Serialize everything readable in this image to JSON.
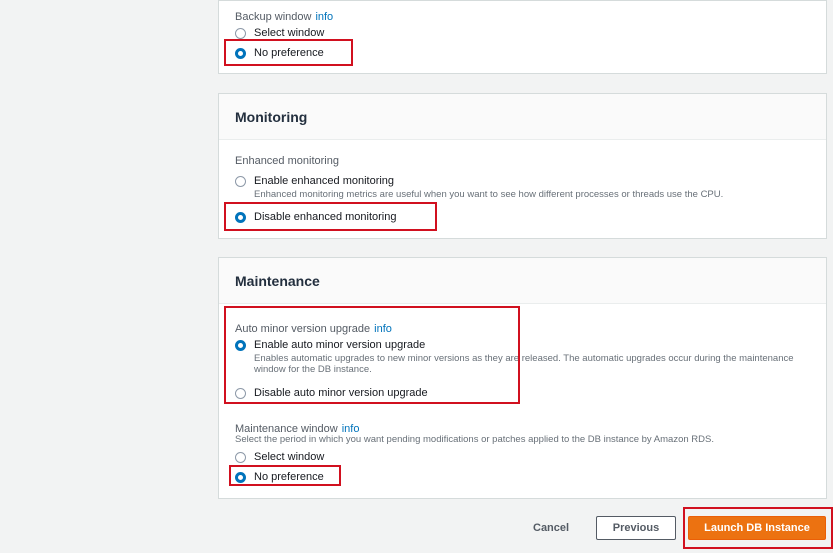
{
  "backup": {
    "label": "Backup window",
    "info": "info",
    "options": [
      "Select window",
      "No preference"
    ]
  },
  "monitoring": {
    "title": "Monitoring",
    "label": "Enhanced monitoring",
    "enable_label": "Enable enhanced monitoring",
    "enable_desc": "Enhanced monitoring metrics are useful when you want to see how different processes or threads use the CPU.",
    "disable_label": "Disable enhanced monitoring"
  },
  "maintenance": {
    "title": "Maintenance",
    "auto_label": "Auto minor version upgrade",
    "auto_info": "info",
    "enable_label": "Enable auto minor version upgrade",
    "enable_desc_1": "Enables automatic upgrades to new minor versions as they are released. The automatic upgrades occur during the maintenance",
    "enable_desc_2": "window for the DB instance.",
    "disable_label": "Disable auto minor version upgrade",
    "window_label": "Maintenance window",
    "window_info": "info",
    "window_desc": "Select the period in which you want pending modifications or patches applied to the DB instance by Amazon RDS.",
    "window_options": [
      "Select window",
      "No preference"
    ]
  },
  "footer": {
    "cancel": "Cancel",
    "previous": "Previous",
    "launch": "Launch DB Instance"
  },
  "colors": {
    "accent": "#0073bb",
    "primary_button": "#ec7211",
    "highlight": "#d1101f"
  }
}
